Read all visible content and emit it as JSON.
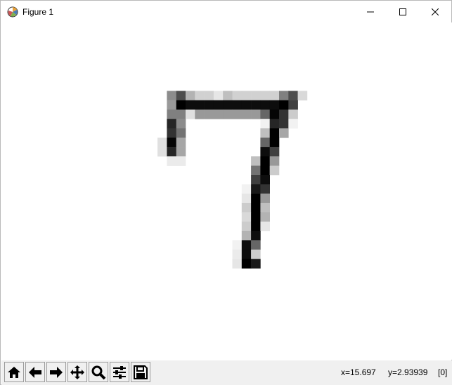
{
  "window": {
    "title": "Figure 1"
  },
  "toolbar": {
    "buttons": [
      "home-icon",
      "back-icon",
      "forward-icon",
      "pan-icon",
      "zoom-icon",
      "configure-subplots-icon",
      "save-icon"
    ]
  },
  "status": {
    "x": "x=15.697",
    "y": "y=2.93939",
    "value": "[0]"
  },
  "image": {
    "description_grid": "28x28 grayscale pixels (0=white,1=black) cropped region rows 4-16",
    "rows": [
      {
        "r": 5,
        "cells": [
          [
            8,
            0.45
          ],
          [
            9,
            0.7
          ],
          [
            10,
            0.3
          ],
          [
            11,
            0.18
          ],
          [
            12,
            0.18
          ],
          [
            13,
            0.1
          ],
          [
            14,
            0.25
          ],
          [
            15,
            0.18
          ],
          [
            16,
            0.18
          ],
          [
            17,
            0.18
          ],
          [
            18,
            0.18
          ],
          [
            19,
            0.18
          ],
          [
            20,
            0.5
          ],
          [
            21,
            0.7
          ],
          [
            22,
            0.15
          ]
        ]
      },
      {
        "r": 6,
        "cells": [
          [
            8,
            0.4
          ],
          [
            9,
            1
          ],
          [
            10,
            0.95
          ],
          [
            11,
            0.95
          ],
          [
            12,
            0.95
          ],
          [
            13,
            0.95
          ],
          [
            14,
            0.95
          ],
          [
            15,
            0.95
          ],
          [
            16,
            0.95
          ],
          [
            17,
            0.95
          ],
          [
            18,
            0.95
          ],
          [
            19,
            0.95
          ],
          [
            20,
            1
          ],
          [
            21,
            0.75
          ]
        ]
      },
      {
        "r": 7,
        "cells": [
          [
            8,
            0.5
          ],
          [
            9,
            0.5
          ],
          [
            10,
            0.12
          ],
          [
            11,
            0.4
          ],
          [
            12,
            0.4
          ],
          [
            13,
            0.4
          ],
          [
            14,
            0.4
          ],
          [
            15,
            0.4
          ],
          [
            16,
            0.4
          ],
          [
            17,
            0.4
          ],
          [
            18,
            0.6
          ],
          [
            19,
            0.98
          ],
          [
            20,
            0.8
          ],
          [
            21,
            0.2
          ]
        ]
      },
      {
        "r": 8,
        "cells": [
          [
            8,
            0.85
          ],
          [
            9,
            0.45
          ],
          [
            18,
            0.05
          ],
          [
            19,
            0.85
          ],
          [
            20,
            0.8
          ],
          [
            21,
            0.05
          ]
        ]
      },
      {
        "r": 9,
        "cells": [
          [
            8,
            0.8
          ],
          [
            9,
            0.55
          ],
          [
            18,
            0.25
          ],
          [
            19,
            1
          ],
          [
            20,
            0.35
          ]
        ]
      },
      {
        "r": 10,
        "cells": [
          [
            7,
            0.12
          ],
          [
            8,
            0.98
          ],
          [
            9,
            0.35
          ],
          [
            18,
            0.6
          ],
          [
            19,
            1
          ]
        ]
      },
      {
        "r": 11,
        "cells": [
          [
            7,
            0.12
          ],
          [
            8,
            0.85
          ],
          [
            9,
            0.35
          ],
          [
            18,
            0.95
          ],
          [
            19,
            0.75
          ]
        ]
      },
      {
        "r": 12,
        "cells": [
          [
            8,
            0.08
          ],
          [
            9,
            0.08
          ],
          [
            17,
            0.25
          ],
          [
            18,
            1
          ],
          [
            19,
            0.4
          ]
        ]
      },
      {
        "r": 13,
        "cells": [
          [
            17,
            0.55
          ],
          [
            18,
            1
          ],
          [
            19,
            0.2
          ]
        ]
      },
      {
        "r": 14,
        "cells": [
          [
            17,
            0.75
          ],
          [
            18,
            0.95
          ]
        ]
      },
      {
        "r": 15,
        "cells": [
          [
            16,
            0.05
          ],
          [
            17,
            0.9
          ],
          [
            18,
            0.8
          ]
        ]
      },
      {
        "r": 16,
        "cells": [
          [
            16,
            0.1
          ],
          [
            17,
            1
          ],
          [
            18,
            0.4
          ]
        ]
      },
      {
        "r": 17,
        "cells": [
          [
            16,
            0.2
          ],
          [
            17,
            1
          ],
          [
            18,
            0.25
          ]
        ]
      },
      {
        "r": 18,
        "cells": [
          [
            16,
            0.15
          ],
          [
            17,
            1
          ],
          [
            18,
            0.3
          ]
        ]
      },
      {
        "r": 19,
        "cells": [
          [
            16,
            0.2
          ],
          [
            17,
            1
          ],
          [
            18,
            0.1
          ]
        ]
      },
      {
        "r": 20,
        "cells": [
          [
            16,
            0.3
          ],
          [
            17,
            0.95
          ]
        ]
      },
      {
        "r": 21,
        "cells": [
          [
            15,
            0.05
          ],
          [
            16,
            0.95
          ],
          [
            17,
            0.6
          ]
        ]
      },
      {
        "r": 22,
        "cells": [
          [
            15,
            0.08
          ],
          [
            16,
            0.95
          ],
          [
            17,
            0.2
          ]
        ]
      },
      {
        "r": 23,
        "cells": [
          [
            15,
            0.1
          ],
          [
            16,
            1
          ],
          [
            17,
            0.9
          ]
        ]
      }
    ]
  }
}
